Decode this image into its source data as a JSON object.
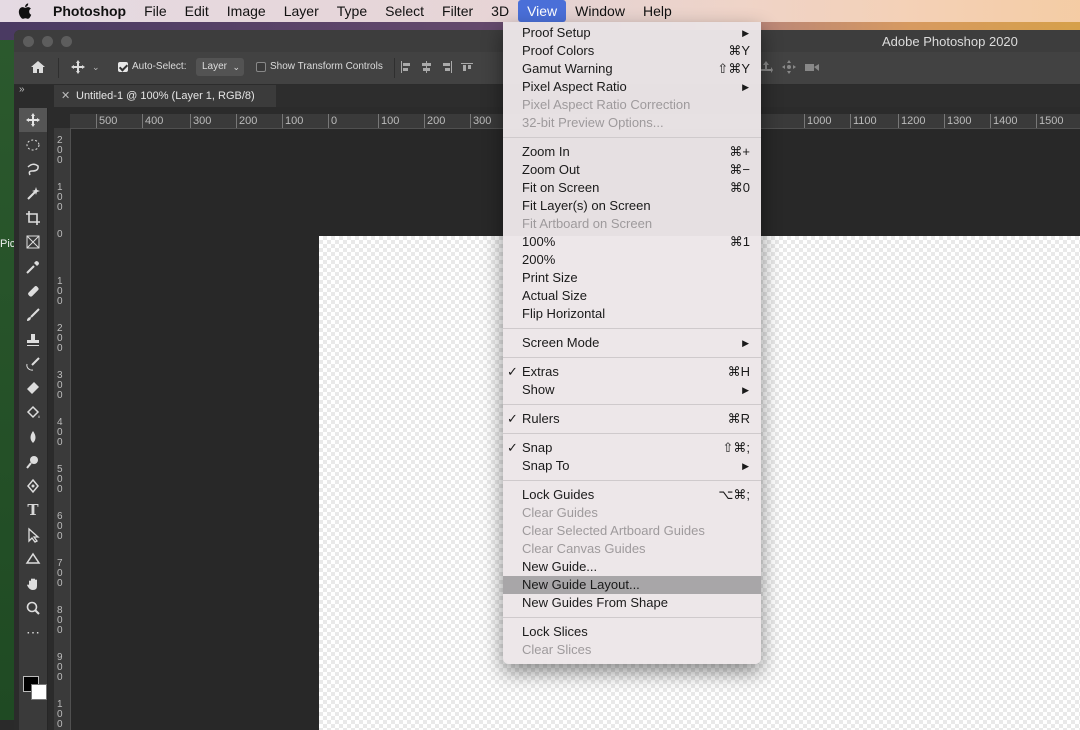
{
  "menubar": {
    "app": "Photoshop",
    "items": [
      "File",
      "Edit",
      "Image",
      "Layer",
      "Type",
      "Select",
      "Filter",
      "3D",
      "View",
      "Window",
      "Help"
    ]
  },
  "window": {
    "title": "Adobe Photoshop 2020"
  },
  "options": {
    "auto_select_label": "Auto-Select:",
    "auto_select_value": "Layer",
    "show_transform": "Show Transform Controls"
  },
  "document": {
    "tab_title": "Untitled-1 @ 100% (Layer 1, RGB/8)"
  },
  "ruler_top_labels": [
    "500",
    "400",
    "300",
    "200",
    "100",
    "0",
    "100",
    "200",
    "300",
    "1000",
    "1100",
    "1200",
    "1300",
    "1400",
    "1500"
  ],
  "ruler_left_labels": [
    "200",
    "100",
    "0",
    "100",
    "200",
    "300",
    "400",
    "500",
    "600",
    "700",
    "800",
    "900",
    "1000"
  ],
  "side_text": "Pict",
  "view_menu": {
    "groups": [
      [
        {
          "label": "Proof Setup",
          "submenu": true
        },
        {
          "label": "Proof Colors",
          "shortcut": "⌘Y"
        },
        {
          "label": "Gamut Warning",
          "shortcut": "⇧⌘Y"
        },
        {
          "label": "Pixel Aspect Ratio",
          "submenu": true
        },
        {
          "label": "Pixel Aspect Ratio Correction",
          "disabled": true
        },
        {
          "label": "32-bit Preview Options...",
          "disabled": true
        }
      ],
      [
        {
          "label": "Zoom In",
          "shortcut": "⌘+"
        },
        {
          "label": "Zoom Out",
          "shortcut": "⌘−"
        },
        {
          "label": "Fit on Screen",
          "shortcut": "⌘0"
        },
        {
          "label": "Fit Layer(s) on Screen"
        },
        {
          "label": "Fit Artboard on Screen",
          "disabled": true
        },
        {
          "label": "100%",
          "shortcut": "⌘1"
        },
        {
          "label": "200%"
        },
        {
          "label": "Print Size"
        },
        {
          "label": "Actual Size"
        },
        {
          "label": "Flip Horizontal"
        }
      ],
      [
        {
          "label": "Screen Mode",
          "submenu": true
        }
      ],
      [
        {
          "label": "Extras",
          "shortcut": "⌘H",
          "checked": true
        },
        {
          "label": "Show",
          "submenu": true
        }
      ],
      [
        {
          "label": "Rulers",
          "shortcut": "⌘R",
          "checked": true
        }
      ],
      [
        {
          "label": "Snap",
          "shortcut": "⇧⌘;",
          "checked": true
        },
        {
          "label": "Snap To",
          "submenu": true
        }
      ],
      [
        {
          "label": "Lock Guides",
          "shortcut": "⌥⌘;"
        },
        {
          "label": "Clear Guides",
          "disabled": true
        },
        {
          "label": "Clear Selected Artboard Guides",
          "disabled": true
        },
        {
          "label": "Clear Canvas Guides",
          "disabled": true
        },
        {
          "label": "New Guide..."
        },
        {
          "label": "New Guide Layout...",
          "highlighted": true
        },
        {
          "label": "New Guides From Shape"
        }
      ],
      [
        {
          "label": "Lock Slices"
        },
        {
          "label": "Clear Slices",
          "disabled": true
        }
      ]
    ]
  },
  "icons": {
    "check": "✓",
    "submenu_arrow": "▶"
  }
}
